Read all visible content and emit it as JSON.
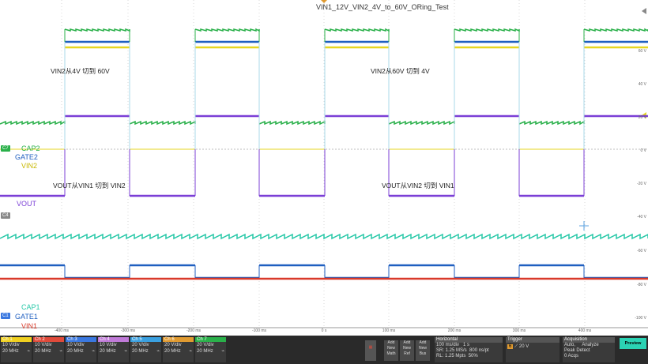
{
  "title": "VIN1_12V_VIN2_4V_to_60V_ORing_Test",
  "annotations": {
    "a1": "VIN2从4V 切到 60V",
    "a2": "VIN2从60V 切到 4V",
    "a3": "VOUT从VIN1 切到 VIN2",
    "a4": "VOUT从VIN2 切到 VIN1"
  },
  "trace_labels": {
    "cap2": "CAP2",
    "gate2": "GATE2",
    "vin2": "VIN2",
    "vout": "VOUT",
    "cap1": "CAP1",
    "gate1": "GATE1",
    "vin1": "VIN1"
  },
  "markers": {
    "c7": "C7",
    "c4": "C4",
    "c1": "C1"
  },
  "right_axis": [
    "60 V",
    "40 V",
    "20 V",
    "0 V",
    "-20 V",
    "-40 V",
    "-60 V",
    "-80 V",
    "-100 V"
  ],
  "time_axis": [
    "-400 ms",
    "-300 ms",
    "-200 ms",
    "-100 ms",
    "0 s",
    "100 ms",
    "200 ms",
    "300 ms",
    "400 ms"
  ],
  "channels": [
    {
      "name": "Ch 1",
      "l1": "10 V/div",
      "l2": "20 MHz",
      "color": "#f0d020"
    },
    {
      "name": "Ch 2",
      "l1": "10 V/div",
      "l2": "20 MHz",
      "color": "#e04a3a"
    },
    {
      "name": "Ch 3",
      "l1": "10 V/div",
      "l2": "20 MHz",
      "color": "#3a78e0"
    },
    {
      "name": "Ch 4",
      "l1": "10 V/div",
      "l2": "20 MHz",
      "color": "#c07ad8"
    },
    {
      "name": "Ch 5",
      "l1": "20 V/div",
      "l2": "20 MHz",
      "color": "#3aa0e0"
    },
    {
      "name": "Ch 6",
      "l1": "20 V/div",
      "l2": "20 MHz",
      "color": "#e09a30"
    },
    {
      "name": "Ch 7",
      "l1": "20 V/div",
      "l2": "20 MHz",
      "color": "#2ab04a"
    }
  ],
  "buttons": {
    "math": "Add New Math",
    "ref": "Add New Ref",
    "bus": "Add New Bus"
  },
  "horizontal": {
    "header": "Horizontal",
    "scale": "100 ms/div",
    "record": "1 s",
    "sr": "SR: 1.25 MS/s",
    "pts": "800 ns/pt",
    "rl": "RL: 1.25 Mpts",
    "pct": "50%"
  },
  "trigger": {
    "header": "Trigger",
    "source": "6",
    "level": "20 V"
  },
  "acquisition": {
    "header": "Acquisition",
    "mode": "Auto,",
    "analyze": "Analyze",
    "detect": "Peak Detect",
    "acqs": "0 Acqs"
  },
  "preview": "Preview",
  "colors": {
    "cap": "#2ab04a",
    "gate": "#1f5fc0",
    "vin2": "#e6d620",
    "vout": "#7b3fd6",
    "vin1": "#d93a2a",
    "cap1": "#28c8a8"
  }
}
